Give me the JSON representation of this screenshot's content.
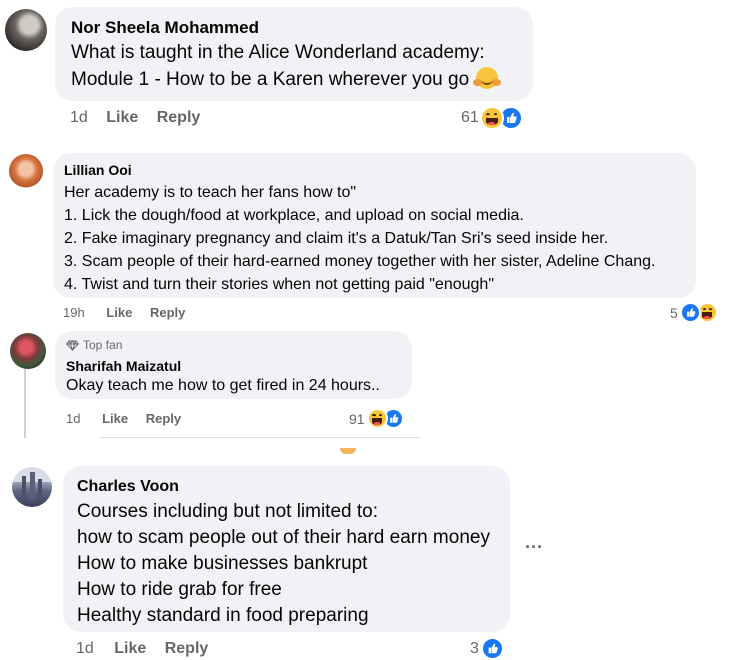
{
  "comments": [
    {
      "author": "Nor Sheela Mohammed",
      "lines": [
        "What is taught in the Alice Wonderland academy:",
        "Module 1 - How to be a Karen wherever you go"
      ],
      "time": "1d",
      "like_label": "Like",
      "reply_label": "Reply",
      "reaction_count": "61",
      "reaction_icons": [
        "haha-icon",
        "like-icon"
      ]
    },
    {
      "author": "Lillian Ooi",
      "lines": [
        "Her academy is to teach her fans how to\"",
        "1. Lick the dough/food at workplace, and upload on social media.",
        "2. Fake imaginary pregnancy and claim it's a Datuk/Tan Sri's seed inside her.",
        "3. Scam people of their hard-earned money together with her sister, Adeline Chang.",
        "4. Twist and turn their stories when not getting paid \"enough\""
      ],
      "time": "19h",
      "like_label": "Like",
      "reply_label": "Reply",
      "reaction_count": "5",
      "reaction_icons": [
        "like-icon",
        "haha-icon"
      ]
    },
    {
      "badge": "Top fan",
      "author": "Sharifah Maizatul",
      "lines": [
        "Okay teach me how to get fired in 24 hours.."
      ],
      "time": "1d",
      "like_label": "Like",
      "reply_label": "Reply",
      "reaction_count": "91",
      "reaction_icons": [
        "haha-icon",
        "like-icon"
      ]
    },
    {
      "author": "Charles Voon",
      "lines": [
        "Courses including but not limited to:",
        "how to scam people out of their hard earn money",
        "How to make businesses bankrupt",
        "How to ride grab for free",
        "Healthy standard in food preparing"
      ],
      "time": "1d",
      "like_label": "Like",
      "reply_label": "Reply",
      "reaction_count": "3",
      "reaction_icons": [
        "like-icon"
      ],
      "more_label": "···"
    }
  ],
  "colors": {
    "bubble": "#f0f2f5",
    "meta": "#65676b",
    "like_blue": "#1877f2",
    "haha_yellow": "#f7c53b"
  }
}
